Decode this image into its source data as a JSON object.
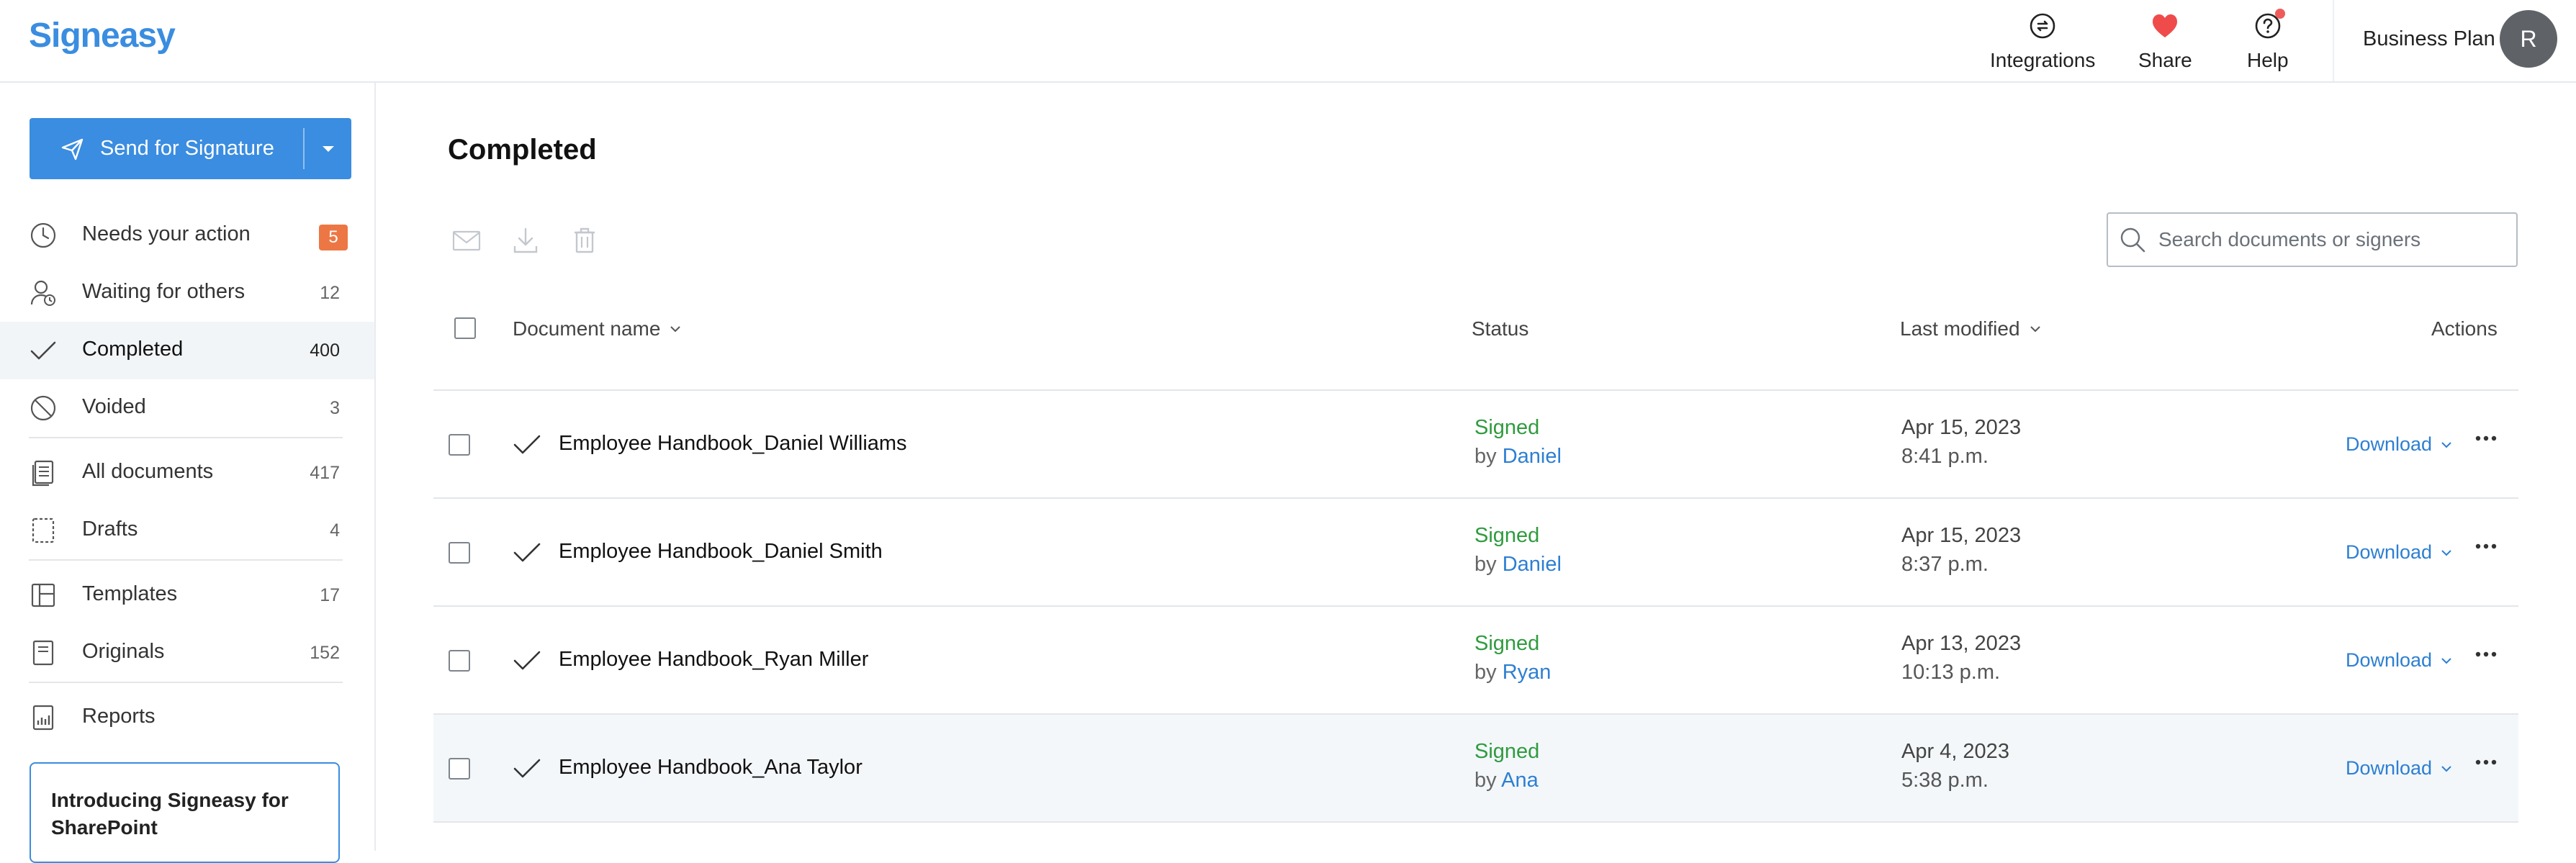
{
  "header": {
    "logo": "Signeasy",
    "nav": [
      {
        "label": "Integrations",
        "icon": "integrations-icon"
      },
      {
        "label": "Share",
        "icon": "heart-icon"
      },
      {
        "label": "Help",
        "icon": "help-icon"
      }
    ],
    "plan": "Business Plan",
    "avatar_initial": "R"
  },
  "sidebar": {
    "send_button": "Send for Signature",
    "items": [
      {
        "label": "Needs your action",
        "count": "5",
        "icon": "clock-icon"
      },
      {
        "label": "Waiting for others",
        "count": "12",
        "icon": "user-waiting-icon"
      },
      {
        "label": "Completed",
        "count": "400",
        "icon": "check-icon"
      },
      {
        "label": "Voided",
        "count": "3",
        "icon": "void-icon"
      },
      {
        "label": "All documents",
        "count": "417",
        "icon": "documents-icon"
      },
      {
        "label": "Drafts",
        "count": "4",
        "icon": "draft-icon"
      },
      {
        "label": "Templates",
        "count": "17",
        "icon": "template-icon"
      },
      {
        "label": "Originals",
        "count": "152",
        "icon": "original-icon"
      },
      {
        "label": "Reports",
        "icon": "reports-icon"
      }
    ],
    "promo": "Introducing Signeasy for SharePoint"
  },
  "main": {
    "title": "Completed",
    "toolbar": [
      "email-icon",
      "download-icon",
      "trash-icon"
    ],
    "search_placeholder": "Search documents or signers",
    "columns": {
      "document_name": "Document name",
      "status": "Status",
      "last_modified": "Last modified",
      "actions": "Actions"
    },
    "rows": [
      {
        "name": "Employee Handbook_Daniel Williams",
        "status": "Signed",
        "by_prefix": "by",
        "signer": "Daniel",
        "date": "Apr 15, 2023",
        "time": "8:41 p.m.",
        "action": "Download"
      },
      {
        "name": "Employee Handbook_Daniel Smith",
        "status": "Signed",
        "by_prefix": "by",
        "signer": "Daniel",
        "date": "Apr 15, 2023",
        "time": "8:37 p.m.",
        "action": "Download"
      },
      {
        "name": "Employee Handbook_Ryan Miller",
        "status": "Signed",
        "by_prefix": "by",
        "signer": "Ryan",
        "date": "Apr 13, 2023",
        "time": "10:13 p.m.",
        "action": "Download"
      },
      {
        "name": "Employee Handbook_Ana Taylor",
        "status": "Signed",
        "by_prefix": "by",
        "signer": "Ana",
        "date": "Apr 4, 2023",
        "time": "5:38 p.m.",
        "action": "Download"
      }
    ]
  },
  "colors": {
    "brand": "#3a8de0",
    "badge": "#ed7744",
    "signed": "#2f9b3e",
    "link": "#2d7fd2",
    "heart": "#ef4b4b"
  }
}
